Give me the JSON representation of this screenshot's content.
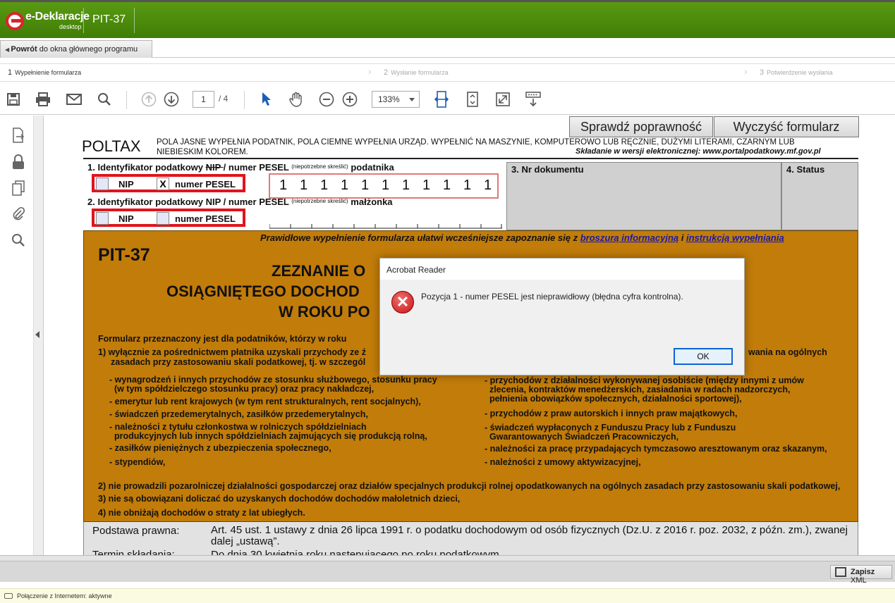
{
  "app": {
    "logo_text": "e-Deklaracje",
    "logo_sub": "desktop",
    "title": "PIT-37"
  },
  "back": {
    "bold": "Powrót",
    "rest": " do okna głównego programu"
  },
  "steps": [
    {
      "num": "1",
      "label": "Wypełnienie formularza"
    },
    {
      "num": "2",
      "label": "Wysłanie formularza"
    },
    {
      "num": "3",
      "label": "Potwierdzenie wysłania"
    }
  ],
  "toolbar": {
    "page_current": "1",
    "page_total": "/ 4",
    "zoom": "133%"
  },
  "form": {
    "btn_check": "Sprawdź poprawność",
    "btn_clear": "Wyczyść formularz",
    "poltax": "POLTAX",
    "header_text": "POLA JASNE WYPEŁNIA PODATNIK, POLA CIEMNE WYPEŁNIA URZĄD. WYPEŁNIĆ NA MASZYNIE, KOMPUTEROWO LUB RĘCZNIE, DUŻYMI LITERAMI, CZARNYM LUB NIEBIESKIM KOLOREM.",
    "header_right": "Składanie w wersji elektronicznej: www.portalpodatkowy.mf.gov.pl",
    "f1_a": "1. Identyfikator podatkowy ",
    "f1_nip_strike": "NIP ",
    "f1_b": "/ numer PESEL ",
    "f1_small": "(niepotrzebne skreślić)",
    "f1_c": " podatnika",
    "f2_a": "2. Identyfikator podatkowy  NIP  / numer PESEL ",
    "f2_small": "(niepotrzebne skreślić)",
    "f2_c": " małżonka",
    "nip_label": "NIP",
    "pesel_label": "numer PESEL",
    "checked_mark": "X",
    "pesel_digits": [
      "1",
      "1",
      "1",
      "1",
      "1",
      "1",
      "1",
      "1",
      "1",
      "1",
      "1"
    ],
    "nr_dok": "3. Nr dokumentu",
    "status": "4. Status",
    "info_prefix": "Prawidłowe wypełnienie formularza ułatwi wcześniejsze zapoznanie się z ",
    "info_link1": "broszurą informacyjną",
    "info_mid": "  i ",
    "info_link2": "instrukcją wypełniania",
    "pit": "PIT-37",
    "title1": "ZEZNANIE O",
    "title2": "OSIĄGNIĘTEGO DOCHOD",
    "title3": "W ROKU PO",
    "intro": "Formularz przeznaczony jest dla podatników, którzy w roku",
    "p1a": "1) wyłącznie za pośrednictwem płatnika uzyskali przychody ze ź",
    "p1b": "zasadach przy zastosowaniu skali podatkowej, tj. w szczegól",
    "p1_right": "wania na ogólnych",
    "left_items": [
      "- wynagrodzeń i innych przychodów ze stosunku służbowego, stosunku pracy",
      "  (w tym spółdzielczego stosunku pracy) oraz pracy nakładczej,",
      "- emerytur lub rent krajowych (w tym rent strukturalnych, rent socjalnych),",
      "- świadczeń przedemerytalnych, zasiłków przedemerytalnych,",
      "- należności z tytułu członkostwa w rolniczych spółdzielniach",
      "  produkcyjnych lub innych spółdzielniach zajmujących się produkcją rolną,",
      "- zasiłków pieniężnych z ubezpieczenia społecznego,",
      "- stypendiów,"
    ],
    "right_items": [
      "- przychodów z działalności wykonywanej osobiście (między innymi z umów",
      "  zlecenia, kontraktów menedżerskich, zasiadania w radach nadzorczych,",
      "  pełnienia obowiązków społecznych, działalności sportowej),",
      "- przychodów z praw autorskich i innych praw majątkowych,",
      "- świadczeń wypłaconych z Funduszu Pracy lub z Funduszu",
      "  Gwarantowanych Świadczeń Pracowniczych,",
      "- należności za pracę przypadających tymczasowo aresztowanym oraz skazanym,",
      "- należności z umowy aktywizacyjnej,"
    ],
    "p2": "2) nie prowadzili pozarolniczej działalności gospodarczej oraz działów specjalnych produkcji rolnej opodatkowanych na ogólnych zasadach przy zastosowaniu skali podatkowej,",
    "p3": "3) nie są obowiązani doliczać do uzyskanych dochodów dochodów małoletnich dzieci,",
    "p4": "4) nie obniżają dochodów o straty z lat ubiegłych.",
    "pod_label": "Podstawa prawna:",
    "pod_val": "Art. 45 ust. 1 ustawy z dnia 26 lipca 1991 r. o podatku dochodowym od osób fizycznych (Dz.U. z 2016 r. poz. 2032, z późn. zm.), zwanej  dalej „ustawą”.",
    "termin_label": "Termin składania:",
    "termin_val": "Do dnia 30 kwietnia roku następującego po roku podatkowym."
  },
  "bottom": {
    "save_bold": "Zapisz",
    "save_rest": " XML"
  },
  "statusbar": {
    "text": "Połączenie z Internetem: aktywne"
  },
  "dialog": {
    "title": "Acrobat Reader",
    "message": "Pozycja 1 - numer PESEL jest nieprawidłowy (błędna cyfra kontrolna).",
    "ok": "OK",
    "icon_glyph": "✕"
  },
  "colors": {
    "header_green": "#4a8a0c",
    "form_orange": "#c27c09",
    "error_red": "#e0141e",
    "accent_blue": "#0a64d8"
  }
}
